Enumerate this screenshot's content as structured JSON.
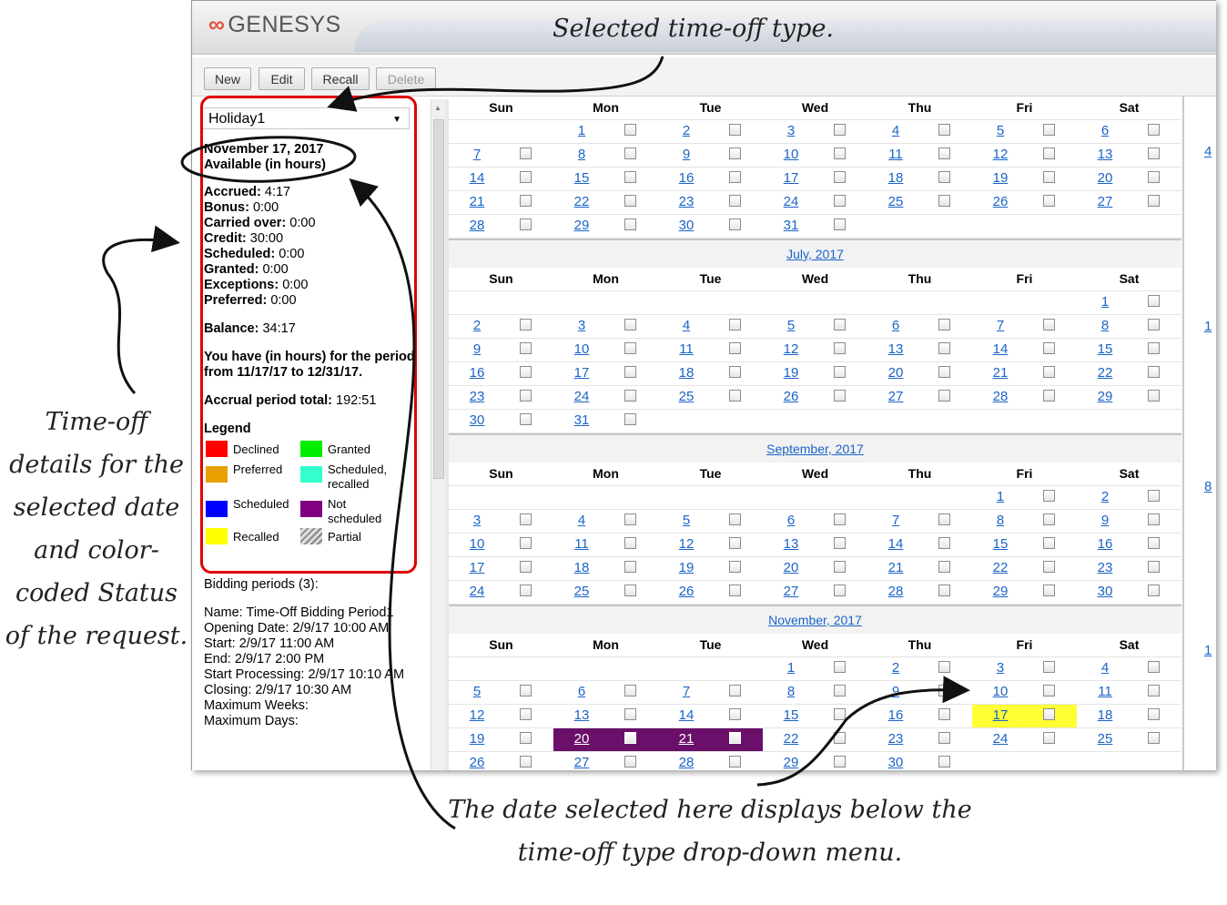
{
  "app": {
    "logo_text": "GENESYS",
    "toolbar": {
      "new": "New",
      "edit": "Edit",
      "recall": "Recall",
      "delete": "Delete"
    }
  },
  "left_panel": {
    "timeoff_type": "Holiday1",
    "selected_date": "November 17, 2017",
    "available_heading": "Available (in hours)",
    "stats": [
      {
        "label": "Accrued:",
        "value": "4:17"
      },
      {
        "label": "Bonus:",
        "value": "0:00"
      },
      {
        "label": "Carried over:",
        "value": "0:00"
      },
      {
        "label": "Credit:",
        "value": "30:00"
      },
      {
        "label": "Scheduled:",
        "value": "0:00"
      },
      {
        "label": "Granted:",
        "value": "0:00"
      },
      {
        "label": "Exceptions:",
        "value": "0:00"
      },
      {
        "label": "Preferred:",
        "value": "0:00"
      }
    ],
    "balance_label": "Balance:",
    "balance_value": "34:17",
    "period_text": "You have (in hours) for the period from 11/17/17 to 12/31/17.",
    "accrual_label": "Accrual period total:",
    "accrual_value": "192:51",
    "legend_title": "Legend",
    "legend": [
      {
        "label": "Declined",
        "color": "#ff0000"
      },
      {
        "label": "Granted",
        "color": "#00ee00"
      },
      {
        "label": "Preferred",
        "color": "#e8a000"
      },
      {
        "label": "Scheduled, recalled",
        "color": "#33ffcc"
      },
      {
        "label": "Scheduled",
        "color": "#0000ff"
      },
      {
        "label": "Not scheduled",
        "color": "#800080"
      },
      {
        "label": "Recalled",
        "color": "#ffff00"
      },
      {
        "label": "Partial",
        "color": "hatched"
      }
    ],
    "bidding": {
      "title": "Bidding periods (3):",
      "rows": [
        {
          "label": "Name:",
          "value": "Time-Off Bidding Period1"
        },
        {
          "label": "Opening Date:",
          "value": "2/9/17 10:00 AM"
        },
        {
          "label": "Start:",
          "value": "2/9/17 11:00 AM"
        },
        {
          "label": "End:",
          "value": "2/9/17 2:00 PM"
        },
        {
          "label": "Start Processing:",
          "value": "2/9/17 10:10 AM"
        },
        {
          "label": "Closing:",
          "value": "2/9/17 10:30 AM"
        },
        {
          "label": "Maximum Weeks:",
          "value": ""
        },
        {
          "label": "Maximum Days:",
          "value": ""
        }
      ]
    }
  },
  "calendar": {
    "weekdays": [
      "Sun",
      "Mon",
      "Tue",
      "Wed",
      "Thu",
      "Fri",
      "Sat"
    ],
    "months": [
      {
        "title": "",
        "first_weekday": 1,
        "days": 31,
        "selected": []
      },
      {
        "title": "July, 2017",
        "first_weekday": 6,
        "days": 31,
        "selected": []
      },
      {
        "title": "September, 2017",
        "first_weekday": 5,
        "days": 30,
        "selected": []
      },
      {
        "title": "November, 2017",
        "first_weekday": 3,
        "days": 30,
        "selected": [
          {
            "day": 17,
            "style": "yellow"
          },
          {
            "day": 20,
            "style": "purple"
          },
          {
            "day": 21,
            "style": "purple"
          }
        ]
      }
    ],
    "partial_next_column": [
      "4",
      "1",
      "8",
      "1"
    ]
  },
  "annotations": {
    "selected_type": "Selected time-off type.",
    "details": "Time-off details for the selected date and color-coded Status of the request.",
    "date_selected": "The date selected here displays below the time-off type drop-down menu."
  }
}
